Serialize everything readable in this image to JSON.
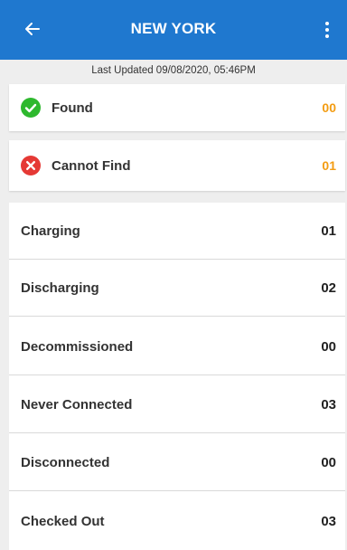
{
  "header": {
    "title": "NEW YORK",
    "back_icon": "arrow-back-icon",
    "menu_icon": "more-vertical-icon"
  },
  "last_updated": "Last Updated 09/08/2020, 05:46PM",
  "status_cards": [
    {
      "label": "Found",
      "value": "00",
      "icon": "check-circle-icon",
      "icon_color": "#2eb82e"
    },
    {
      "label": "Cannot Find",
      "value": "01",
      "icon": "x-circle-icon",
      "icon_color": "#e53935"
    }
  ],
  "counts": [
    {
      "label": "Charging",
      "value": "01"
    },
    {
      "label": "Discharging",
      "value": "02"
    },
    {
      "label": "Decommissioned",
      "value": "00"
    },
    {
      "label": "Never Connected",
      "value": "03"
    },
    {
      "label": "Disconnected",
      "value": "00"
    },
    {
      "label": "Checked Out",
      "value": "03"
    }
  ],
  "colors": {
    "appbar": "#1f78cf",
    "status_value": "#f39c12"
  }
}
